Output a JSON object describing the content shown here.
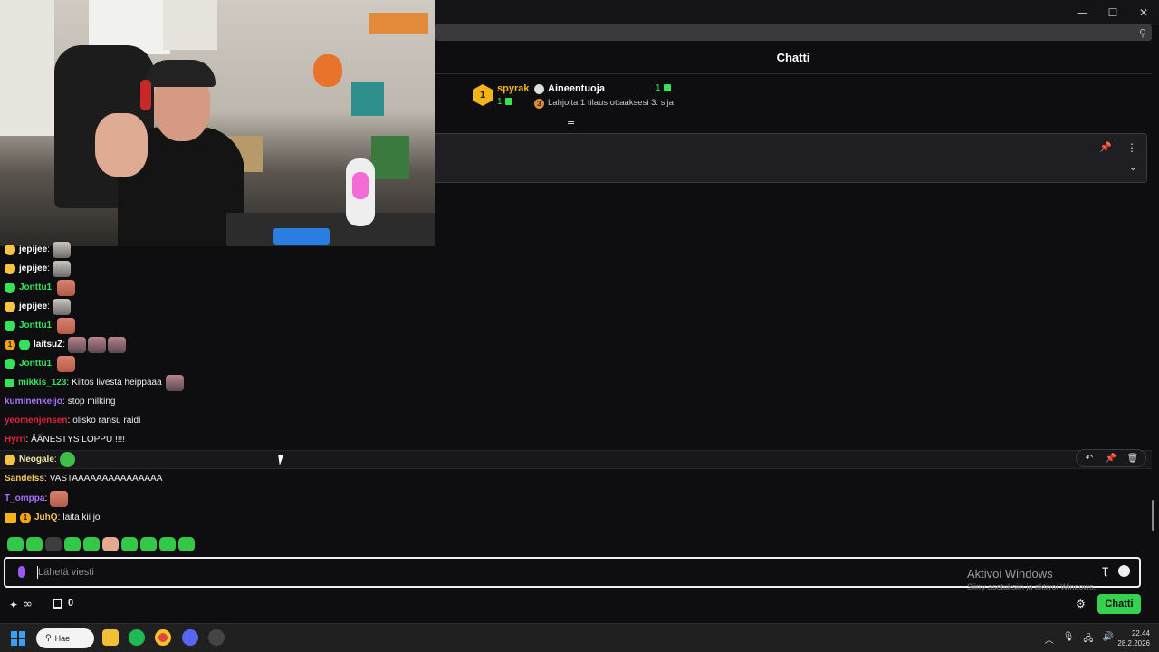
{
  "window": {
    "controls": [
      "—",
      "☐",
      "✕"
    ]
  },
  "header": {
    "title": "Chatti"
  },
  "leaderboard": {
    "rank": "1",
    "top_name": "spyrak",
    "top_count": "1",
    "category_rank": "3",
    "category_title": "Aineentuoja",
    "category_count": "1",
    "category_subtitle": "Lahjoita 1 tilaus ottaaksesi 3. sija"
  },
  "messages": [
    {
      "user": "jepijee",
      "color": "#ffffff",
      "text": "",
      "badges": [
        "gold"
      ],
      "emotes": [
        "ghost"
      ]
    },
    {
      "user": "jepijee",
      "color": "#ffffff",
      "text": "",
      "badges": [
        "gold"
      ],
      "emotes": [
        "ghost"
      ]
    },
    {
      "user": "Jonttu1",
      "color": "#34e35a",
      "text": "",
      "badges": [
        "green"
      ],
      "emotes": [
        "finger"
      ]
    },
    {
      "user": "jepijee",
      "color": "#ffffff",
      "text": "",
      "badges": [
        "gold"
      ],
      "emotes": [
        "ghost"
      ]
    },
    {
      "user": "Jonttu1",
      "color": "#34e35a",
      "text": "",
      "badges": [
        "green"
      ],
      "emotes": [
        "finger"
      ]
    },
    {
      "user": "laitsuZ",
      "color": "#ffffff",
      "text": "",
      "badges": [
        "orange",
        "green"
      ],
      "emotes": [
        "face",
        "face",
        "face"
      ]
    },
    {
      "user": "Jonttu1",
      "color": "#34e35a",
      "text": "",
      "badges": [
        "green"
      ],
      "emotes": [
        "finger"
      ]
    },
    {
      "user": "mikkis_123",
      "color": "#34e35a",
      "text": "Kiitos livestä heippaaa",
      "badges": [
        "sub"
      ],
      "emotes": [
        "face"
      ]
    },
    {
      "user": "kuminenkeijo",
      "color": "#a970ff",
      "text": "stop milking",
      "badges": [],
      "emotes": []
    },
    {
      "user": "yeomenjensen",
      "color": "#e0243a",
      "text": "olisko ransu raidi",
      "badges": [],
      "emotes": []
    },
    {
      "user": "Hyrri",
      "color": "#e0243a",
      "text": "ÄÄNESTYS LOPPU !!!!",
      "badges": [],
      "emotes": []
    },
    {
      "user": "Neogale",
      "color": "#f2e6a0",
      "text": "",
      "badges": [
        "gold"
      ],
      "emotes": [
        "frog"
      ]
    },
    {
      "user": "Sandelss",
      "color": "#f2c35a",
      "text": "VASTAAAAAAAAAAAAAAA",
      "badges": [],
      "emotes": []
    },
    {
      "user": "T_omppa",
      "color": "#a970ff",
      "text": "",
      "badges": [],
      "emotes": [
        "finger"
      ]
    },
    {
      "user": "JuhQ",
      "color": "#f2c35a",
      "text": "laita kii jo",
      "badges": [
        "crown",
        "orange"
      ],
      "emotes": []
    }
  ],
  "colon": ":",
  "message_actions": [
    "↶",
    "📌",
    "🗑"
  ],
  "input": {
    "placeholder": "Lähetä viesti",
    "translate": "Ʈ",
    "emoji": "☻"
  },
  "watermark": {
    "line1": "Aktivoi Windows",
    "line2": "Siirry asetuksiin ja aktivoi Windows."
  },
  "bottom": {
    "points_icon": "✦",
    "points": "∞",
    "store_count": "0",
    "settings": "⚙",
    "chat_button": "Chatti"
  },
  "taskbar": {
    "search": "Hae",
    "time": "22.44",
    "date": "28.2.2026",
    "tray_chevron": "︿",
    "tray_mic": "🎙",
    "tray_net": "🖧",
    "tray_sound": "🔊"
  },
  "icons": {
    "zoom": "⚲",
    "filter": "≡",
    "pin": "📌",
    "more": "⋮",
    "expand": "⌄"
  }
}
